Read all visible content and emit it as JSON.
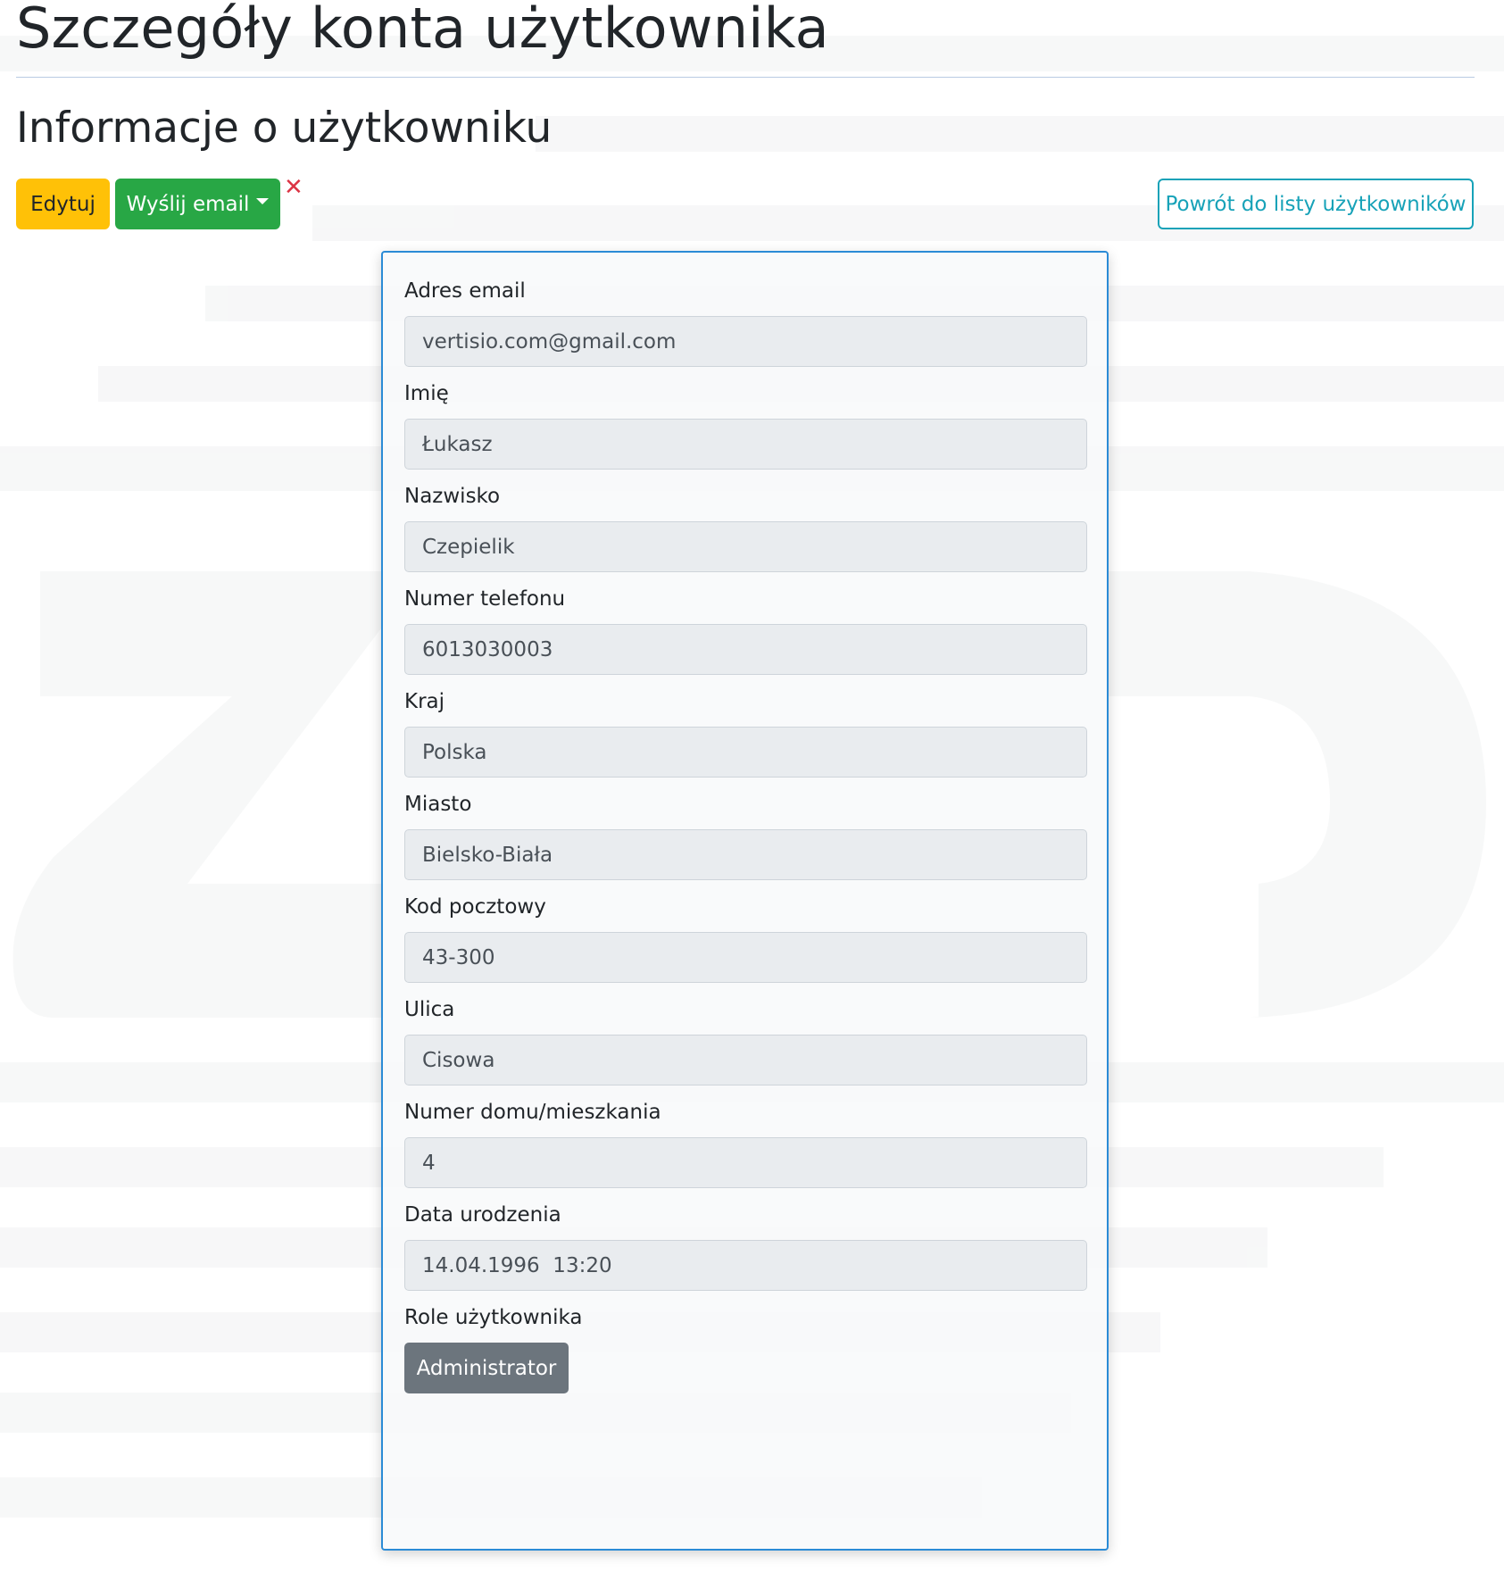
{
  "page": {
    "title": "Szczegóły konta użytkownika",
    "section_title": "Informacje o użytkowniku"
  },
  "actions": {
    "edit_label": "Edytuj",
    "send_email_label": "Wyślij email",
    "delete_icon": "close-icon",
    "back_label": "Powrót do listy użytkowników"
  },
  "colors": {
    "edit": "#ffc107",
    "send_email": "#28a745",
    "delete": "#dc3545",
    "back": "#17a2b8",
    "card_border": "#2b8bd6",
    "role_badge": "#6c757d"
  },
  "fields": [
    {
      "label": "Adres email",
      "value": "vertisio.com@gmail.com"
    },
    {
      "label": "Imię",
      "value": "Łukasz"
    },
    {
      "label": "Nazwisko",
      "value": "Czepielik"
    },
    {
      "label": "Numer telefonu",
      "value": "6013030003"
    },
    {
      "label": "Kraj",
      "value": "Polska"
    },
    {
      "label": "Miasto",
      "value": "Bielsko-Biała"
    },
    {
      "label": "Kod pocztowy",
      "value": "43-300"
    },
    {
      "label": "Ulica",
      "value": "Cisowa"
    },
    {
      "label": "Numer domu/mieszkania",
      "value": "4"
    },
    {
      "label": "Data urodzenia",
      "value": "14.04.1996  13:20"
    }
  ],
  "roles": {
    "label": "Role użytkownika",
    "items": [
      "Administrator"
    ]
  }
}
